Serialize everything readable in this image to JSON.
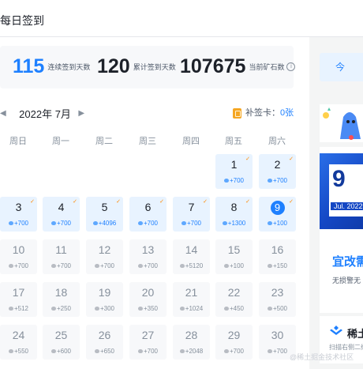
{
  "page": {
    "title": "每日签到"
  },
  "stats": {
    "consecutive_days": "115",
    "consecutive_label": "连续签到天数",
    "total_days": "120",
    "total_label": "累计签到天数",
    "ore": "107675",
    "ore_label": "当前矿石数"
  },
  "calendar": {
    "month_label": "2022年 7月",
    "makeup_label": "补签卡：",
    "makeup_count": "0张",
    "weekdays": [
      "周日",
      "周一",
      "周二",
      "周三",
      "周四",
      "周五",
      "周六"
    ],
    "days": [
      {
        "day": "1",
        "points": "+700",
        "done": true,
        "checked": true
      },
      {
        "day": "2",
        "points": "+700",
        "done": true,
        "checked": true
      },
      {
        "day": "3",
        "points": "+700",
        "done": true,
        "checked": true
      },
      {
        "day": "4",
        "points": "+700",
        "done": true,
        "checked": true
      },
      {
        "day": "5",
        "points": "+4096",
        "done": true,
        "checked": true
      },
      {
        "day": "6",
        "points": "+700",
        "done": true,
        "checked": true
      },
      {
        "day": "7",
        "points": "+700",
        "done": true,
        "checked": true
      },
      {
        "day": "8",
        "points": "+1300",
        "done": true,
        "checked": true
      },
      {
        "day": "9",
        "points": "+100",
        "done": true,
        "checked": true,
        "today": true
      },
      {
        "day": "10",
        "points": "+700",
        "done": false
      },
      {
        "day": "11",
        "points": "+700",
        "done": false
      },
      {
        "day": "12",
        "points": "+700",
        "done": false
      },
      {
        "day": "13",
        "points": "+700",
        "done": false
      },
      {
        "day": "14",
        "points": "+5120",
        "done": false
      },
      {
        "day": "15",
        "points": "+100",
        "done": false
      },
      {
        "day": "16",
        "points": "+150",
        "done": false
      },
      {
        "day": "17",
        "points": "+512",
        "done": false
      },
      {
        "day": "18",
        "points": "+250",
        "done": false
      },
      {
        "day": "19",
        "points": "+300",
        "done": false
      },
      {
        "day": "20",
        "points": "+350",
        "done": false
      },
      {
        "day": "21",
        "points": "+1024",
        "done": false
      },
      {
        "day": "22",
        "points": "+450",
        "done": false
      },
      {
        "day": "23",
        "points": "+500",
        "done": false
      },
      {
        "day": "24",
        "points": "+550",
        "done": false
      },
      {
        "day": "25",
        "points": "+600",
        "done": false
      },
      {
        "day": "26",
        "points": "+650",
        "done": false
      },
      {
        "day": "27",
        "points": "+700",
        "done": false
      },
      {
        "day": "28",
        "points": "+2048",
        "done": false
      },
      {
        "day": "29",
        "points": "+700",
        "done": false
      },
      {
        "day": "30",
        "points": "+700",
        "done": false
      }
    ]
  },
  "sidebar": {
    "promo_date": "9",
    "promo_month": "Jul. 2022",
    "promo_title": "宜改需",
    "promo_sub": "无损警无",
    "brand_name": "稀土",
    "brand_sub": "扫描右侧二维"
  },
  "watermark": "@稀土掘金技术社区",
  "colors": {
    "accent": "#1e80ff",
    "checked": "#ff8800",
    "done_bg": "#e8f3ff"
  }
}
